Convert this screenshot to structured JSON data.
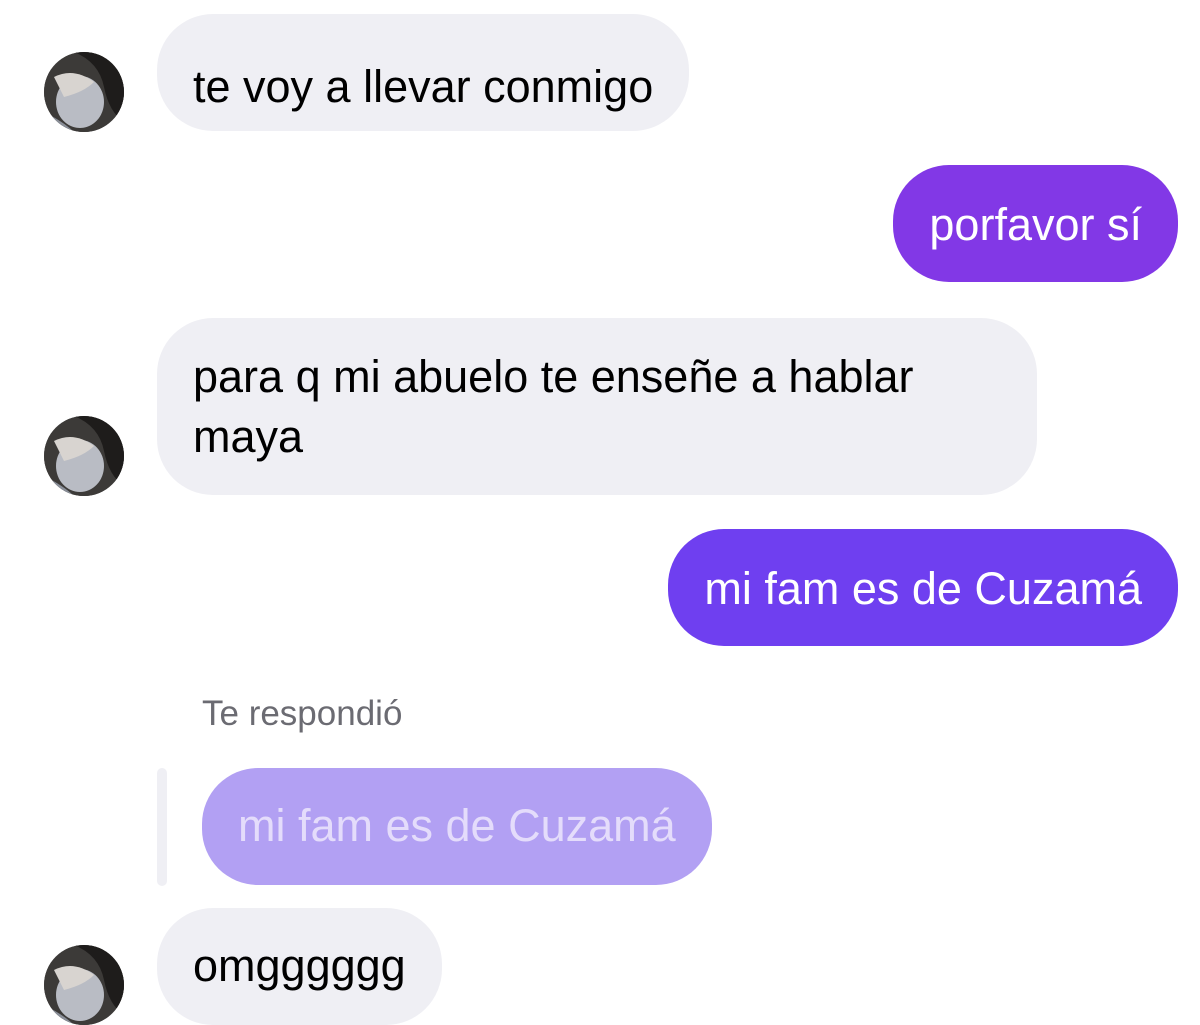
{
  "conversation": {
    "messages": [
      {
        "sender": "them",
        "text": "te voy a llevar conmigo"
      },
      {
        "sender": "me",
        "text": "porfavor sí"
      },
      {
        "sender": "them",
        "text": "para q mi abuelo te enseñe a hablar maya"
      },
      {
        "sender": "me",
        "text": "mi fam es de Cuzamá"
      },
      {
        "sender": "them",
        "text": "omgggggg"
      }
    ],
    "reply": {
      "label": "Te respondió",
      "quoted_text": "mi fam es de Cuzamá"
    }
  },
  "colors": {
    "incoming_bubble": "#efeff4",
    "outgoing_bubble_top": "#8238e6",
    "outgoing_bubble_bottom": "#6f3ff0",
    "quoted_bubble": "#b2a0f3"
  },
  "icons": {
    "avatar": "contact-avatar-photo"
  }
}
